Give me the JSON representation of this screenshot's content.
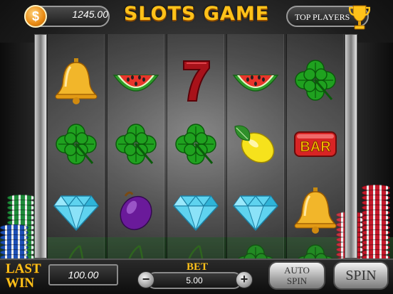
{
  "header": {
    "currency_symbol": "$",
    "balance": "1245.00",
    "title": "SLOTS GAME",
    "top_players_label": "TOP PLAYERS"
  },
  "reels": [
    [
      "bell-icon",
      "clover-icon",
      "diamond-icon",
      "cherry-icon"
    ],
    [
      "watermelon-icon",
      "clover-icon",
      "plum-icon",
      "cherry-icon"
    ],
    [
      "seven-icon",
      "clover-icon",
      "diamond-icon",
      "cherry-icon"
    ],
    [
      "watermelon-icon",
      "lemon-icon",
      "diamond-icon",
      "clover-icon"
    ],
    [
      "clover-icon",
      "bar-icon",
      "bell-icon",
      "clover-icon"
    ]
  ],
  "bar_symbol_text": "BAR",
  "bottom": {
    "last_win_label_1": "LAST",
    "last_win_label_2": "WIN",
    "last_win_value": "100.00",
    "bet_label": "BET",
    "bet_value": "5.00",
    "minus_label": "−",
    "plus_label": "+",
    "auto_spin_label_1": "AUTO",
    "auto_spin_label_2": "SPIN",
    "spin_label": "SPIN"
  },
  "colors": {
    "gold": "#ffc21a",
    "clover": "#1fa11f",
    "diamond": "#5fd3ef",
    "chip_green": "#1e8b3a",
    "chip_red": "#c4192a",
    "chip_blue": "#1d4fb5"
  }
}
